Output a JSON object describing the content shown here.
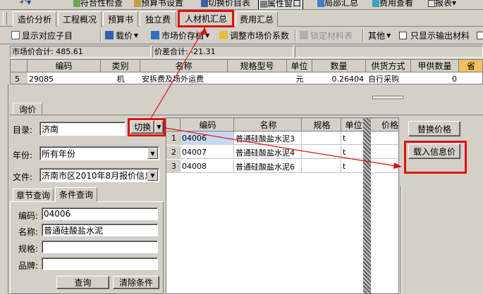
{
  "top_toolbar": {
    "items": [
      "符合性检查",
      "预算书设置",
      "切换价目表",
      "属性窗口",
      "局部汇总",
      "费用查看",
      "报表"
    ]
  },
  "main_tabs": [
    "造价分析",
    "工程概况",
    "预算书",
    "独立费",
    "人材机汇总",
    "费用汇总"
  ],
  "sub_toolbar": {
    "show_child": "显示对应子目",
    "load_price": "载价",
    "market_file": "市场价存档",
    "adjust_coef": "调整市场价系数",
    "lock_table": "锁定材料表",
    "other": "其他",
    "only_output": "只显示输出材料"
  },
  "summary": {
    "market_total": "市场价合计: 485.61",
    "diff_total": "价差合计: -21.31"
  },
  "upper_table": {
    "headers": [
      "编码",
      "类别",
      "名称",
      "规格型号",
      "单位",
      "数量",
      "供货方式",
      "甲供数量",
      "省"
    ],
    "row": {
      "idx": "5",
      "code": "29085",
      "type": "机",
      "name": "安拆费及场外运费",
      "spec": "",
      "unit": "元",
      "qty": "0.26404",
      "supply": "自行采购",
      "a_qty": "0"
    }
  },
  "query_tab": "询价",
  "left_panel": {
    "dir_label": "目录:",
    "dir_value": "济南",
    "switch_btn": "切换",
    "year_label": "年份:",
    "year_value": "所有年份",
    "file_label": "文件:",
    "file_value": "济南市区2010年8月报价信息",
    "tab_chapter": "章节查询",
    "tab_condition": "条件查询",
    "code_label": "编码:",
    "code_value": "04006",
    "name_label": "名称:",
    "name_value": "普通硅酸盐水泥",
    "spec_label": "规格:",
    "spec_value": "",
    "brand_label": "品牌:",
    "brand_value": "",
    "query_btn": "查询",
    "clear_btn": "清除条件"
  },
  "result_table": {
    "headers": [
      "编码",
      "名称",
      "规格",
      "单位",
      "价格"
    ],
    "rows": [
      {
        "idx": "1",
        "code": "04006",
        "name": "普通硅酸盐水泥3",
        "spec": "",
        "unit": "t",
        "price": ""
      },
      {
        "idx": "2",
        "code": "04007",
        "name": "普通硅酸盐水泥4",
        "spec": "",
        "unit": "t",
        "price": ""
      },
      {
        "idx": "3",
        "code": "04008",
        "name": "普通硅酸盐水泥6",
        "spec": "",
        "unit": "t",
        "price": ""
      }
    ]
  },
  "right_buttons": {
    "replace_price": "替换价格",
    "load_info_price": "载入信息价"
  },
  "colors": {
    "highlight_red": "#e01010",
    "selection": "#c8d8f0",
    "face": "#d4d0c8"
  }
}
